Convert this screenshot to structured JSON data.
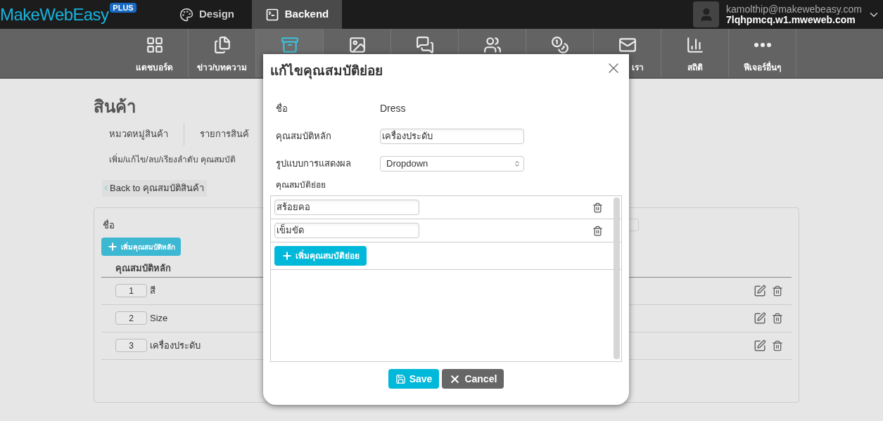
{
  "brand": {
    "name": "MakeWebEasy",
    "badge": "PLUS"
  },
  "mode_tabs": [
    {
      "kind": "design",
      "label": "Design",
      "selected": false
    },
    {
      "kind": "backend",
      "label": "Backend",
      "selected": true
    }
  ],
  "account": {
    "email": "kamolthip@makewebeasy.com",
    "site": "7lqhpmcq.w1.mweweb.com"
  },
  "nav": [
    {
      "kind": "grid",
      "label": "แดชบอร์ด",
      "selected": false
    },
    {
      "kind": "pages",
      "label": "ข่าว/บทความ",
      "selected": false
    },
    {
      "kind": "box",
      "selected": true
    },
    {
      "kind": "image",
      "selected": false
    },
    {
      "kind": "chat",
      "selected": false
    },
    {
      "kind": "people",
      "selected": false
    },
    {
      "kind": "coins",
      "selected": false
    },
    {
      "kind": "mail",
      "label": "เรา",
      "cut": true,
      "selected": false
    },
    {
      "kind": "stats",
      "label": "สถิติ",
      "selected": false
    },
    {
      "kind": "more",
      "label": "ฟีเจอร์อื่นๆ",
      "selected": false
    }
  ],
  "page": {
    "title": "สินค้า",
    "tabs": [
      "หมวดหมู่สินค้า",
      "รายการสินค้"
    ],
    "subtitle": "เพิ่ม/แก้ไข/ลบ/เรียงลำดับ คุณสมบัติ",
    "back_link": "Back to คุณสมบัติสินค้า",
    "card": {
      "name_label": "ชื่อ",
      "add_button": "เพิ่มคุณสมบัติหลัก",
      "column": "คุณสมบัติหลัก",
      "rows": [
        {
          "order": "1",
          "name": "สี"
        },
        {
          "order": "2",
          "name": "Size"
        },
        {
          "order": "3",
          "name": "เครื่องประดับ"
        }
      ]
    }
  },
  "modal": {
    "title": "แก้ไขคุณสมบัติย่อย",
    "fields": [
      {
        "kind": "text",
        "label": "ชื่อ",
        "value": "Dress"
      },
      {
        "kind": "input",
        "label": "คุณสมบัติหลัก",
        "value": "เครื่องประดับ"
      },
      {
        "kind": "select",
        "label": "รูปแบบการแสดงผล",
        "value": "Dropdown"
      }
    ],
    "sub_label": "คุณสมบัติย่อย",
    "sub_items": [
      {
        "value": "สร้อยคอ"
      },
      {
        "value": "เข็มขัด"
      }
    ],
    "add_button": "เพิ่มคุณสมบัติย่อย",
    "save": "Save",
    "cancel": "Cancel"
  }
}
